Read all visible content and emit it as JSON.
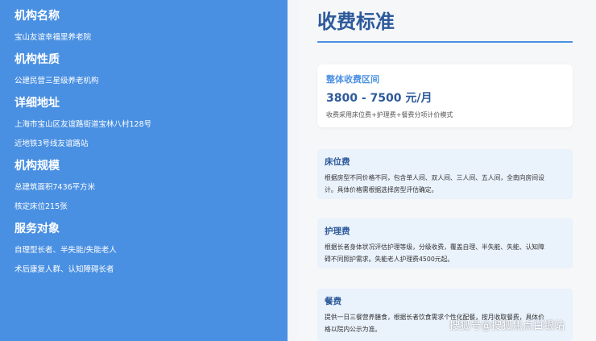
{
  "left": {
    "sections": [
      {
        "title": "机构名称",
        "lines": [
          "宝山友谊幸福里养老院"
        ]
      },
      {
        "title": "机构性质",
        "lines": [
          "公建民营三星级养老机构"
        ]
      },
      {
        "title": "详细地址",
        "lines": [
          "上海市宝山区友谊路街道宝林八村128号",
          "近地铁3号线友谊路站"
        ]
      },
      {
        "title": "机构规模",
        "lines": [
          "总建筑面积7436平方米",
          "核定床位215张"
        ]
      },
      {
        "title": "服务对象",
        "lines": [
          "自理型长者、半失能/失能老人",
          "术后康复人群、认知障碍长者"
        ]
      }
    ]
  },
  "right": {
    "title": "收费标准",
    "price": {
      "label": "整体收费区间",
      "range": "3800 - 7500 元/月",
      "note": "收费采用床位费+护理费+餐费分项计价模式"
    },
    "fees": [
      {
        "title": "床位费",
        "lines": [
          "根据房型不同价格不同，包含单人间、双人间、三人间、五人间，全南向房间设",
          "计。具体价格需根据选择房型评估确定。"
        ]
      },
      {
        "title": "护理费",
        "lines": [
          "根据长者身体状况评估护理等级，分级收费，覆盖自理、半失能、失能、认知障",
          "碍不同照护需求。失能老人护理费4500元起。"
        ]
      },
      {
        "title": "餐费",
        "lines": [
          "提供一日三餐营养膳食，根据长者饮食需求个性化配餐，按月收取餐费，具体价",
          "格以院内公示为准。"
        ]
      }
    ]
  },
  "watermark": "搜狐号@搜狐焦点白银站",
  "colors": {
    "left_bg": "#4a90e2",
    "title": "#2d5a9b",
    "card_bg": "#eaf2fc"
  }
}
